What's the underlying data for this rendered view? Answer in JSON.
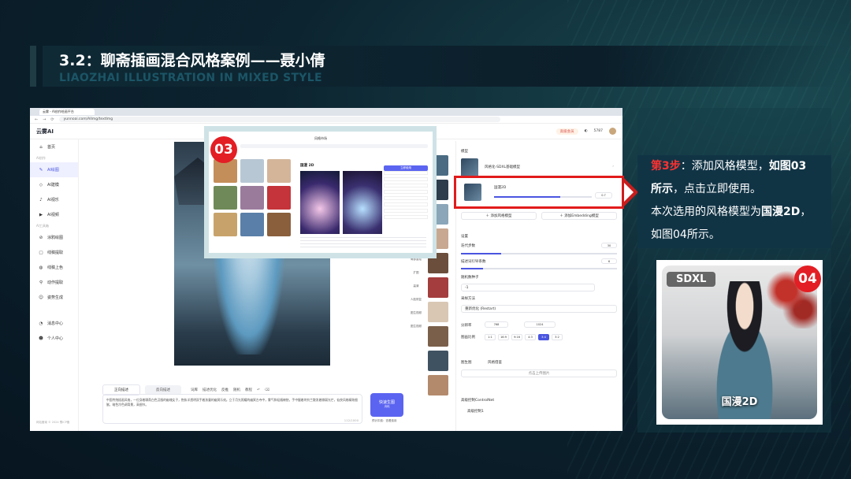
{
  "slide": {
    "title_cn": "3.2：聊斋插画混合风格案例——聂小倩",
    "title_en": "LIAOZHAI ILLUSTRATION IN MIXED STYLE"
  },
  "browser": {
    "tab_label": "云雾 - AI创作绘画平台",
    "url": "yunnoai.com/AIImg/textImg",
    "nav_icons": [
      "back-icon",
      "forward-icon",
      "refresh-icon"
    ]
  },
  "app": {
    "logo": "云雾AI",
    "topbar": {
      "vip": "高级会员",
      "points": "5787"
    },
    "sidebar": {
      "home": "首页",
      "section_ai": "AI创作",
      "items": [
        "AI绘图",
        "AI建模",
        "AI视乐",
        "AI视频"
      ],
      "section_tools": "AI工具箱",
      "tools": [
        "涂鸦绘图",
        "线稿提取",
        "线稿上色",
        "动作提取",
        "姿势生成"
      ],
      "msg": "消息中心",
      "me": "个人中心",
      "footer": "网站备案 © 2024 蜀ICP备"
    },
    "prompt": {
      "tab1": "正向描述",
      "tab2": "反向描述",
      "tools": [
        "词库",
        "描述优化",
        "反推",
        "随机",
        "教程"
      ],
      "text": "中国传统插画风格，一位身着聊斋白色汉服的幽魂女子，抱执半透明双手着孩童的幽冥乐宛。立于月光照耀的幽冥古寺中，雾气和轻烟缭绕，手中握着的铃兰散发着微弱光芒，仙侠风格精致细腻，暗色冷色调背景，高细节。",
      "count": "112/1000",
      "gen": "快速生图",
      "gen_sub": "消耗",
      "note": "预计扣费：查看费用"
    },
    "tools_col": [
      "局部重绘",
      "扩图",
      "高清",
      "人脸修复",
      "图生视频",
      "图生视频"
    ],
    "panel": {
      "model_label": "模型",
      "model_name": "风格化-SDXL基础模型",
      "lora_label": "国漫2D",
      "lora_value": "0.7",
      "add_style": "添加风格模型",
      "add_emb": "添加Embedding模型",
      "settings": "设置",
      "steps_label": "迭代步数",
      "steps": "30",
      "cfg_label": "描述词引导系数",
      "cfg": "6",
      "seed_label": "随机数种子",
      "seed": "-1",
      "sampler_label": "采样方法",
      "sampler": "重新优化 (Restart)",
      "res_label": "分辨率",
      "w": "768",
      "h": "1024",
      "ratio_label": "图画比例",
      "ratios": [
        "1:1",
        "16:9",
        "9:16",
        "4:3",
        "3:4",
        "3:2"
      ],
      "ratio_selected": "3:4",
      "img2img": "图生图",
      "ref": "风格借鉴",
      "upload": "点击上传图片",
      "controlnet": "高级控制ControlNet",
      "cn_item": "高级控制1"
    }
  },
  "popup": {
    "badge": "03",
    "title": "风格模型选择",
    "model_name": "国漫 2D",
    "use_btn": "立即使用",
    "dialog_title": "风格市场"
  },
  "info": {
    "step_label": "第3步",
    "colon": "：",
    "line1_a": "添加风格模型，",
    "line1_b": "如图03",
    "line2_a": "所示",
    "line2_b": "，点击立即使用。",
    "line3_a": "本次选用的风格模型为",
    "line3_b": "国漫2D",
    "line3_c": "，",
    "line4": "如图04所示。"
  },
  "card": {
    "badge": "04",
    "tag": "SDXL",
    "caption": "国漫2D"
  },
  "colors": {
    "accent": "#5b64f0",
    "highlight": "#e21b1b",
    "badge": "#e31e24",
    "bg": "#0b1e2a"
  }
}
